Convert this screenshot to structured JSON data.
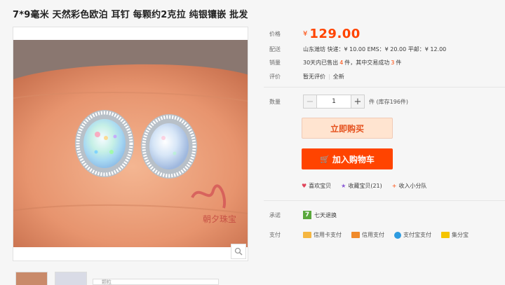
{
  "title": "7*9毫米 天然彩色欧泊 耳钉 每颗约2克拉 纯银镶嵌 批发",
  "price": {
    "label": "价格",
    "currency": "¥",
    "value": "129.00"
  },
  "shipping": {
    "label": "配送",
    "text": "山东潍坊 快递：¥ 10.00  EMS：¥ 20.00  平邮：¥ 12.00"
  },
  "sales": {
    "label": "销量",
    "prefix": "30天内已售出",
    "sold": "4",
    "mid": "件，其中交易成功",
    "success": "3",
    "suffix": "件"
  },
  "reviews": {
    "label": "评价",
    "none": "暂无评价",
    "all": "全新"
  },
  "quantity": {
    "label": "数量",
    "minus": "−",
    "value": "1",
    "plus": "+",
    "unit": "件 (库存196件)"
  },
  "buttons": {
    "buy_now": "立即购买",
    "add_cart": "加入购物车"
  },
  "links": {
    "like": "喜欢宝贝",
    "favorite": "收藏宝贝(21)",
    "group": "收入小分队"
  },
  "promise": {
    "label": "承诺",
    "badge": "7",
    "text": "七天退换"
  },
  "payment": {
    "label": "支付",
    "methods": [
      "信用卡支付",
      "信用支付",
      "支付宝支付",
      "集分宝"
    ]
  },
  "watermark": "朝夕珠宝",
  "thumb_strip_text": "颗粒",
  "colors": {
    "accent": "#ff4400",
    "buy_now_bg": "#ffe4d0",
    "cart_bg": "#ff4400"
  }
}
